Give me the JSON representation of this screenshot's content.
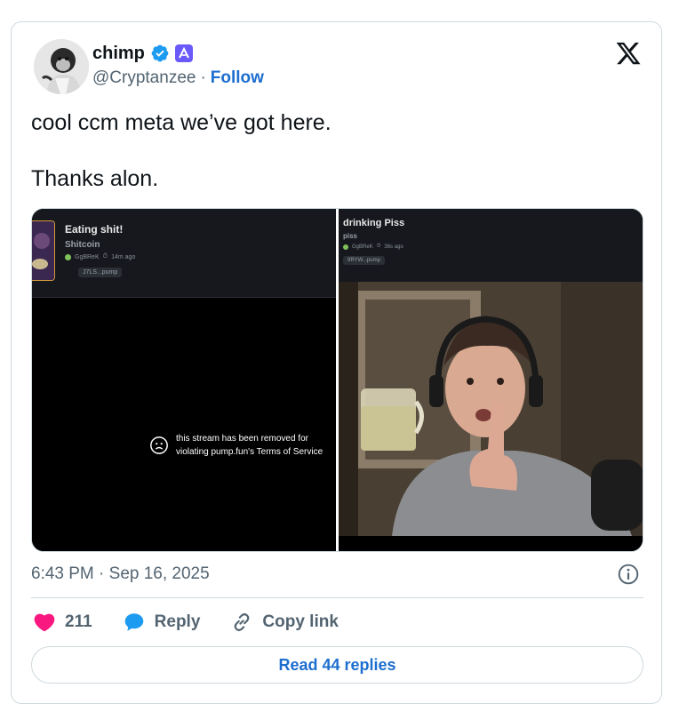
{
  "author": {
    "display_name": "chimp",
    "handle": "@Cryptanzee",
    "separator": "·",
    "follow_label": "Follow"
  },
  "tweet": {
    "line1": "cool ccm meta we’ve got here.",
    "line2": "Thanks alon."
  },
  "media": {
    "left": {
      "title": "Eating shit!",
      "subtitle": "Shitcoin",
      "creator": "GgBReK",
      "age": "14m ago",
      "chip": "J7LS...pump",
      "removed_line1": "this stream has been removed for",
      "removed_line2": "violating pump.fun's Terms of Service"
    },
    "right": {
      "title": "drinking Piss",
      "subtitle": "piss",
      "creator": "GgBReK",
      "age": "36s ago",
      "chip": "9RYW...pump"
    }
  },
  "timestamp": "6:43 PM · Sep 16, 2025",
  "actions": {
    "likes": "211",
    "reply_label": "Reply",
    "copy_label": "Copy link"
  },
  "read_replies_label": "Read 44 replies",
  "colors": {
    "link_blue": "#1d6ecf",
    "verified_blue": "#1d9bf0",
    "like_pink": "#f91880",
    "reply_blue": "#1d9bf0",
    "affiliate_purple": "#6a5af9"
  },
  "icons": [
    "verified-icon",
    "affiliate-badge-icon",
    "x-logo-icon",
    "sad-face-icon",
    "info-icon",
    "heart-icon",
    "reply-icon",
    "link-icon"
  ]
}
